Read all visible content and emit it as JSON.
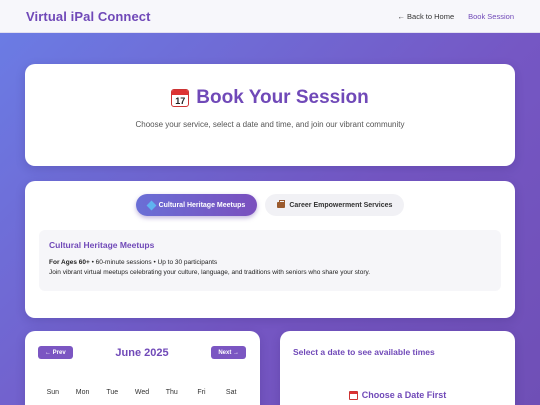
{
  "app": {
    "brand": "Virtual iPal Connect",
    "nav": {
      "back": "← Back to Home",
      "current": "Book Session"
    }
  },
  "hero": {
    "title": "Book Your Session",
    "calendar_icon_label": "July",
    "calendar_icon_day": "17",
    "subtitle": "Choose your service, select a date and time, and join our vibrant community"
  },
  "services": {
    "tabs": [
      {
        "label": "Cultural Heritage Meetups",
        "icon": "gem-icon",
        "active": true
      },
      {
        "label": "Career Empowerment Services",
        "icon": "briefcase-icon",
        "active": false
      }
    ],
    "selected": {
      "title": "Cultural Heritage Meetups",
      "audience": "For Ages 60+",
      "details": " • 60-minute sessions • Up to 30 participants",
      "description": "Join vibrant virtual meetups celebrating your culture, language, and traditions with seniors who share your story."
    }
  },
  "calendar": {
    "prev": "← Prev",
    "next": "Next →",
    "month": "June 2025",
    "weekdays": [
      "Sun",
      "Mon",
      "Tue",
      "Wed",
      "Thu",
      "Fri",
      "Sat"
    ]
  },
  "times": {
    "title": "Select a date to see available times",
    "placeholder": "Choose a Date First"
  },
  "colors": {
    "accent": "#7049b8",
    "button": "#7b56c2"
  }
}
